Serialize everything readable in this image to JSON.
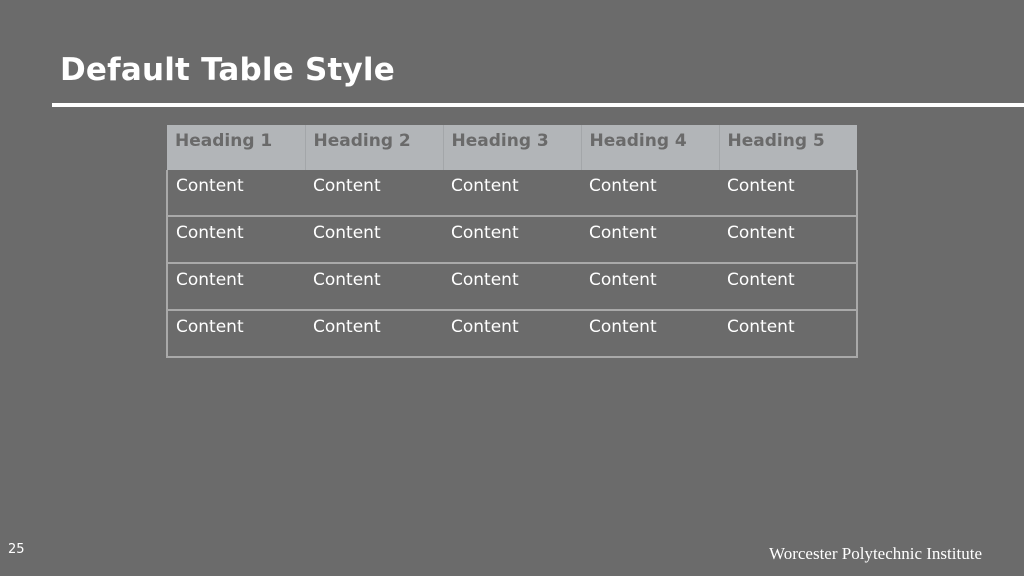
{
  "slide": {
    "title": "Default Table Style",
    "page_number": "25",
    "footer": "Worcester Polytechnic Institute"
  },
  "table": {
    "headers": [
      "Heading 1",
      "Heading 2",
      "Heading 3",
      "Heading 4",
      "Heading 5"
    ],
    "rows": [
      [
        "Content",
        "Content",
        "Content",
        "Content",
        "Content"
      ],
      [
        "Content",
        "Content",
        "Content",
        "Content",
        "Content"
      ],
      [
        "Content",
        "Content",
        "Content",
        "Content",
        "Content"
      ],
      [
        "Content",
        "Content",
        "Content",
        "Content",
        "Content"
      ]
    ]
  },
  "colors": {
    "background": "#6b6b6b",
    "header_fill": "#b2b5b8",
    "header_text": "#6a6a6a",
    "grid_line": "#a9a9a9",
    "text": "#ffffff"
  }
}
